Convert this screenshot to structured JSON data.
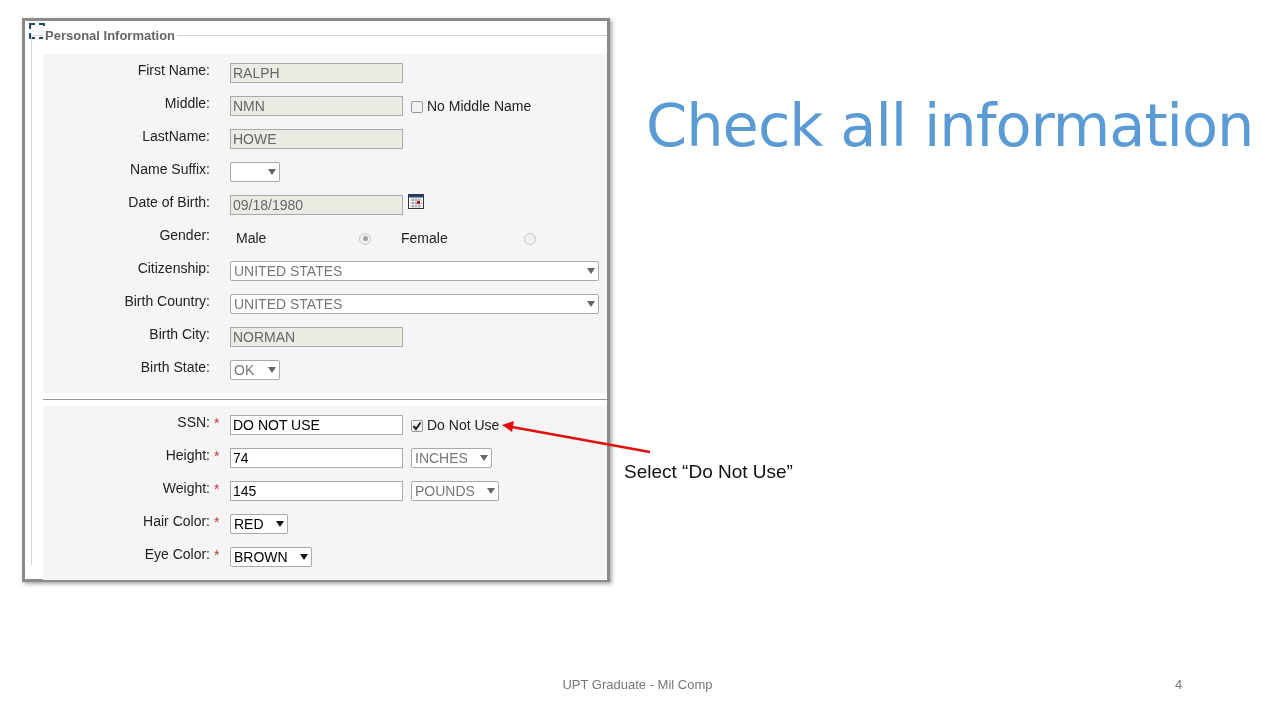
{
  "form": {
    "legend": "Personal Information",
    "sections": [
      {
        "rows": [
          {
            "label": "First Name:",
            "kind": "text",
            "value": "RALPH",
            "disabled": true
          },
          {
            "label": "Middle:",
            "kind": "text",
            "value": "NMN",
            "disabled": true,
            "checkbox": {
              "label": "No Middle Name",
              "checked": false
            }
          },
          {
            "label": "LastName:",
            "kind": "text",
            "value": "HOWE",
            "disabled": true
          },
          {
            "label": "Name Suffix:",
            "kind": "select",
            "value": "",
            "disabled": true
          },
          {
            "label": "Date of Birth:",
            "kind": "date",
            "value": "09/18/1980",
            "disabled": true
          },
          {
            "label": "Gender:",
            "kind": "radio",
            "disabled": true,
            "options": [
              {
                "label": "Male",
                "selected": true
              },
              {
                "label": "Female",
                "selected": false
              }
            ]
          },
          {
            "label": "Citizenship:",
            "kind": "wide-select",
            "value": "UNITED STATES",
            "disabled": true
          },
          {
            "label": "Birth Country:",
            "kind": "wide-select",
            "value": "UNITED STATES",
            "disabled": true
          },
          {
            "label": "Birth City:",
            "kind": "text",
            "value": "NORMAN",
            "disabled": true
          },
          {
            "label": "Birth State:",
            "kind": "select",
            "value": "OK",
            "disabled": true
          }
        ]
      },
      {
        "rows": [
          {
            "label": "SSN:",
            "mark": "*",
            "kind": "text",
            "value": "DO NOT USE",
            "disabled": false,
            "checkbox": {
              "label": "Do Not Use",
              "checked": true
            }
          },
          {
            "label": "Height:",
            "mark": "*",
            "kind": "text",
            "value": "74",
            "disabled": false,
            "unit": {
              "value": "INCHES",
              "disabled": true
            }
          },
          {
            "label": "Weight:",
            "mark": "*",
            "kind": "text",
            "value": "145",
            "disabled": false,
            "unit": {
              "value": "POUNDS",
              "disabled": true
            }
          },
          {
            "label": "Hair Color:",
            "mark": "*",
            "kind": "select",
            "value": "RED",
            "disabled": false
          },
          {
            "label": "Eye Color:",
            "mark": "*",
            "kind": "select",
            "value": "BROWN",
            "disabled": false
          }
        ]
      }
    ]
  },
  "title": "Check all information",
  "callout": "Select “Do Not Use”",
  "footer": {
    "text": "UPT Graduate - Mil Comp",
    "page": "4"
  }
}
